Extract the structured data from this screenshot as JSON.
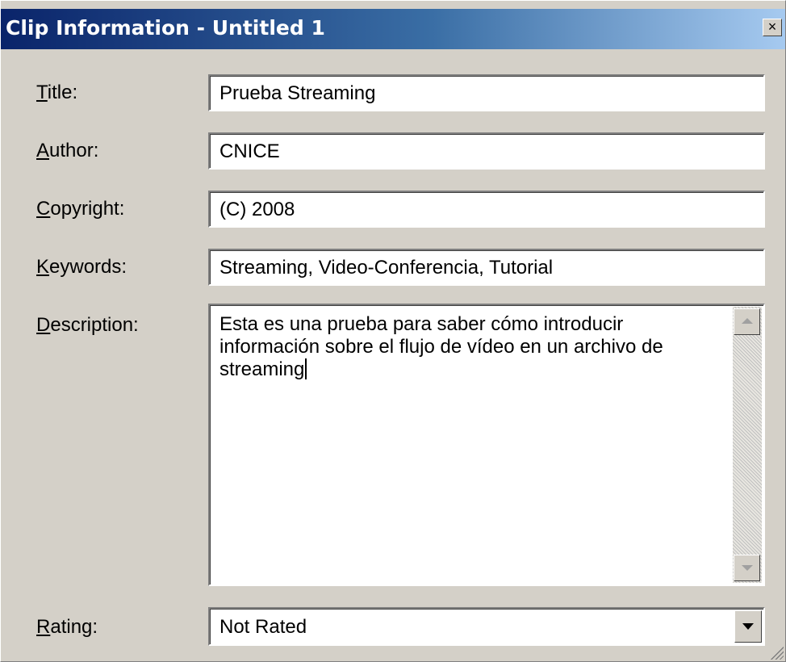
{
  "window": {
    "title": "Clip Information - Untitled 1",
    "close_glyph": "×"
  },
  "fields": {
    "title": {
      "label_mnemonic": "T",
      "label_rest": "itle:",
      "value": "Prueba Streaming"
    },
    "author": {
      "label_mnemonic": "A",
      "label_rest": "uthor:",
      "value": "CNICE"
    },
    "copyright": {
      "label_mnemonic": "C",
      "label_rest": "opyright:",
      "value": "(C) 2008"
    },
    "keywords": {
      "label_mnemonic": "K",
      "label_rest": "eywords:",
      "value": "Streaming, Video-Conferencia, Tutorial"
    },
    "description": {
      "label_mnemonic": "D",
      "label_rest": "escription:",
      "value": "Esta es una prueba para saber cómo introducir información sobre el flujo de vídeo en un archivo de streaming"
    },
    "rating": {
      "label_mnemonic": "R",
      "label_rest": "ating:",
      "value": "Not Rated"
    }
  },
  "icons": {
    "close": "close-icon",
    "scroll_up": "scroll-up-arrow-icon",
    "scroll_down": "scroll-down-arrow-icon",
    "dropdown": "dropdown-arrow-icon",
    "grip": "resize-grip-icon"
  },
  "colors": {
    "titlebar_start": "#0a246a",
    "titlebar_end": "#a6caf0",
    "face": "#d4d0c8"
  }
}
